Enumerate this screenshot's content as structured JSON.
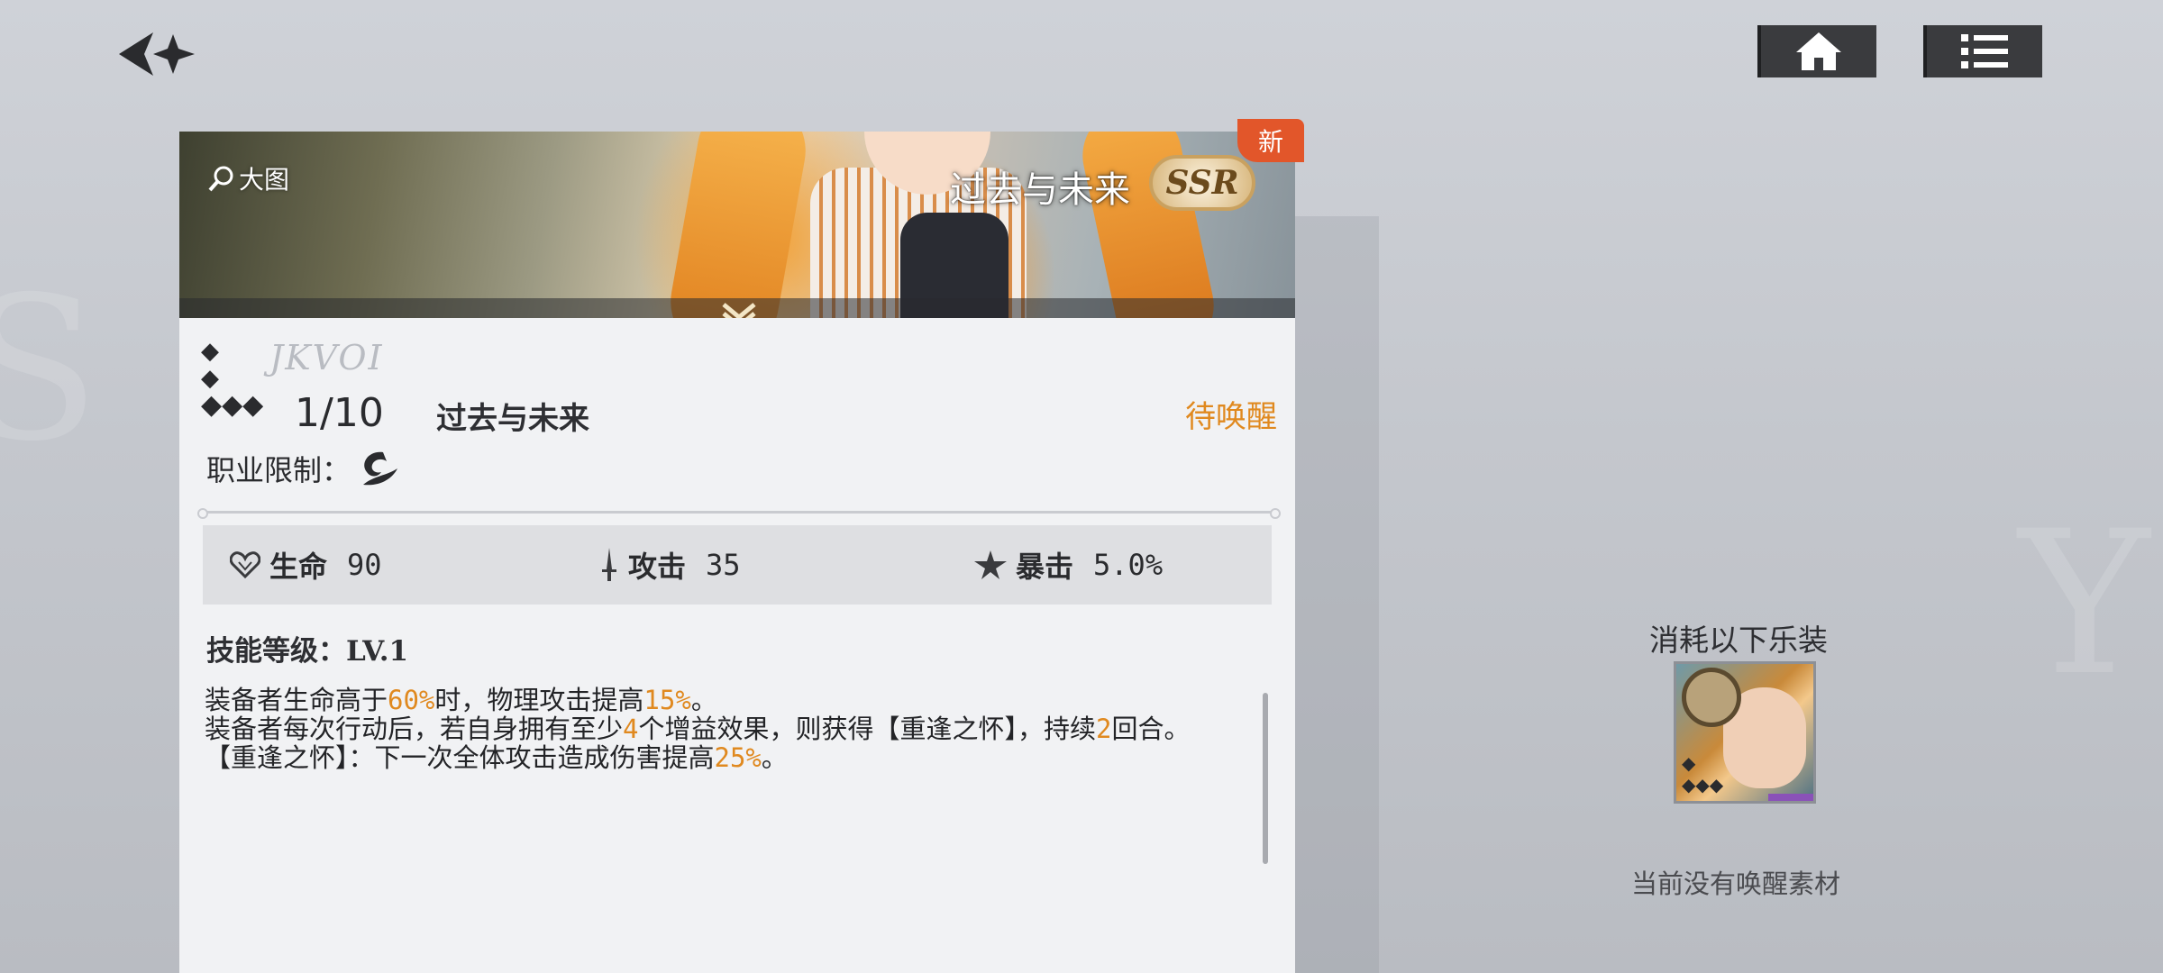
{
  "nav": {
    "back_icon": "back-arrow-star-icon",
    "home_icon": "home-icon",
    "list_icon": "list-icon"
  },
  "card": {
    "banner": {
      "enlarge_label": "大图",
      "title": "过去与未来",
      "rarity": "SSR",
      "new_tag": "新"
    },
    "rarity_marks": [
      "◆",
      "◆",
      "◆◆◆"
    ],
    "level_logo": "JKVOI",
    "level": "1/10",
    "name": "过去与未来",
    "awaken_status": "待唤醒",
    "job_limit_label": "职业限制：",
    "stats": [
      {
        "label": "生命",
        "value": "90",
        "icon": "heart-icon"
      },
      {
        "label": "攻击",
        "value": "35",
        "icon": "sword-icon"
      },
      {
        "label": "暴击",
        "value": "5.0%",
        "icon": "crit-star-icon"
      }
    ],
    "skill_level": "技能等级：LV.1",
    "skill_lines": {
      "l1a": "装备者生命高于",
      "l1b": "60%",
      "l1c": "时，物理攻击提高",
      "l1d": "15%",
      "l1e": "。",
      "l2a": "装备者每次行动后，若自身拥有至少",
      "l2b": "4",
      "l2c": "个增益效果，则获得【重逢之怀】，持续",
      "l2d": "2",
      "l2e": "回合。",
      "l3a": "【重逢之怀】：下一次全体攻击造成伤害提高",
      "l3b": "25%",
      "l3c": "。"
    }
  },
  "side": {
    "consume_title": "消耗以下乐装",
    "no_material": "当前没有唤醒素材"
  },
  "colors": {
    "accent": "#e0891f",
    "new_tag": "#e2562a",
    "button_bg": "#3a3b3e"
  }
}
